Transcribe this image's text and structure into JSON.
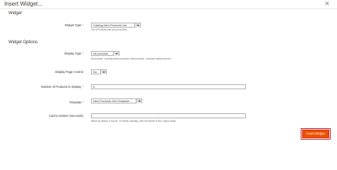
{
  "modal": {
    "title": "Insert Widget...",
    "close_icon": "close-icon"
  },
  "sections": {
    "widget": "Widget",
    "widget_options": "Widget Options"
  },
  "fields": {
    "widget_type": {
      "label": "Widget Type",
      "required": "*",
      "value": "Catalog New Products List",
      "note": "List of Products that are set as New"
    },
    "display_type": {
      "label": "Display Type",
      "required": "*",
      "value": "All products",
      "note": "All products - recently added products, New products - products marked as new"
    },
    "display_page_control": {
      "label": "Display Page Control",
      "value": "No"
    },
    "number_of_products": {
      "label": "Number of Products to Display",
      "required": "*",
      "value": "5"
    },
    "template": {
      "label": "Template",
      "required": "*",
      "value": "New Products Grid Template"
    },
    "cache_lifetime": {
      "label": "Cache Lifetime (Seconds)",
      "value": "",
      "note": "86400 by default, if not set. To refresh instantly, clear the Blocks HTML Output cache."
    }
  },
  "actions": {
    "insert_label": "Insert Widget"
  },
  "colors": {
    "accent": "#eb5202",
    "highlight": "#d42020",
    "required": "#e22626"
  }
}
